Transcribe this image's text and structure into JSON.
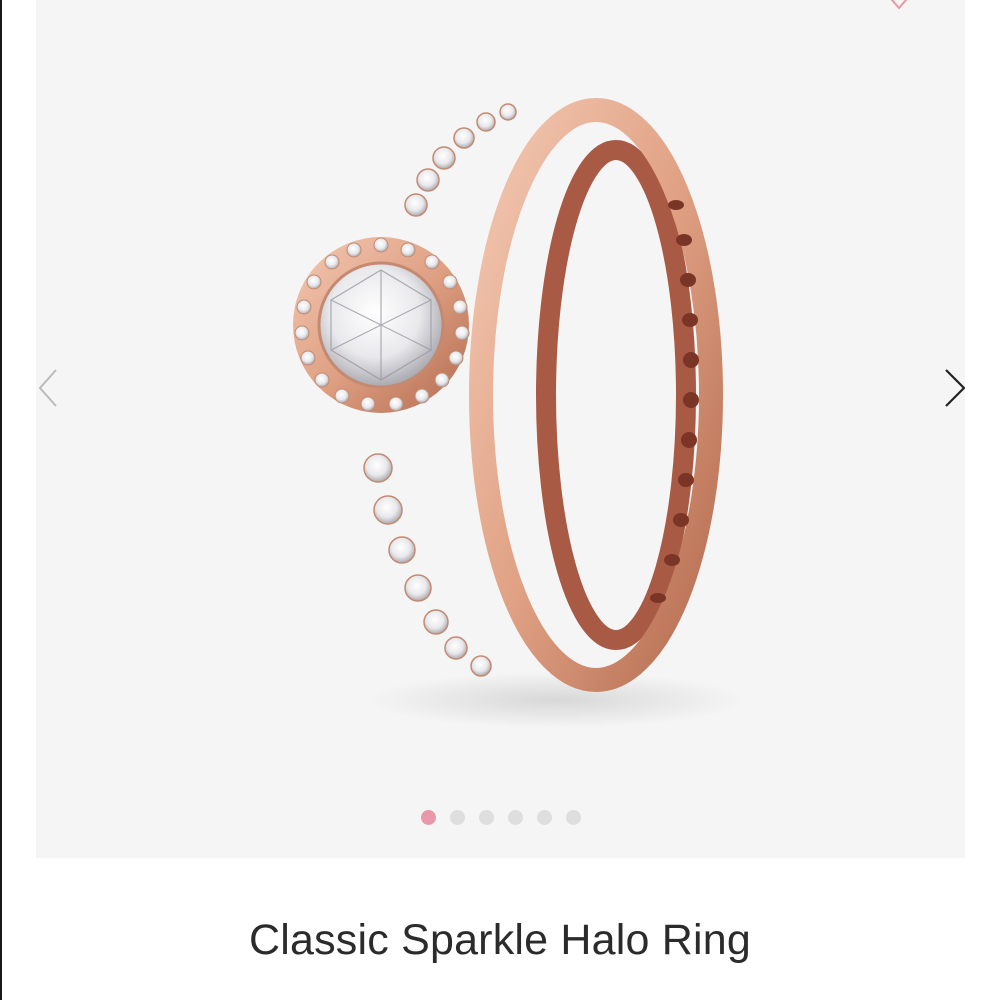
{
  "product": {
    "title": "Classic Sparkle Halo Ring"
  },
  "gallery": {
    "image_alt": "Rose gold halo ring with clear stones",
    "slide_count": 6,
    "active_slide": 1,
    "wishlist_icon": "heart-icon",
    "prev_icon": "chevron-left-icon",
    "next_icon": "chevron-right-icon"
  },
  "colors": {
    "dot_active": "#e998a9",
    "dot_inactive": "#dedede",
    "gallery_bg": "#f5f5f5",
    "rose_gold": "#e0a184",
    "title_text": "#2b2b2b"
  }
}
